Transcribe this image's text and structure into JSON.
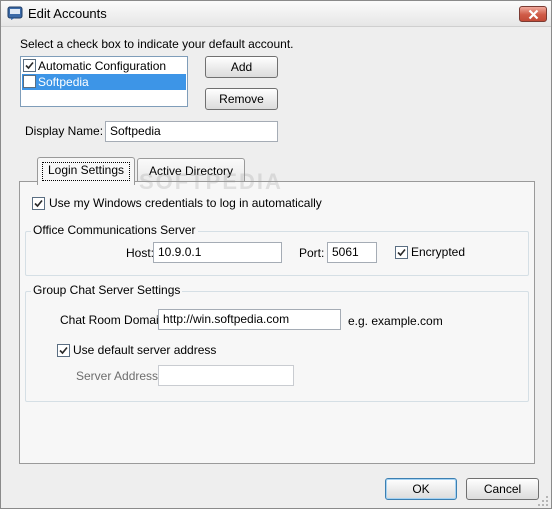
{
  "window": {
    "title": "Edit Accounts"
  },
  "instructions": "Select a check box to indicate your default account.",
  "accounts": [
    {
      "label": "Automatic Configuration",
      "checked": true,
      "selected": false
    },
    {
      "label": "Softpedia",
      "checked": false,
      "selected": true
    }
  ],
  "buttons": {
    "add": "Add",
    "remove": "Remove",
    "ok": "OK",
    "cancel": "Cancel"
  },
  "display_name": {
    "label": "Display Name:",
    "value": "Softpedia"
  },
  "tabs": [
    {
      "label": "Login Settings",
      "active": true
    },
    {
      "label": "Active Directory",
      "active": false
    }
  ],
  "watermark": "SOFTPEDIA",
  "login": {
    "use_windows_credentials": {
      "label": "Use my Windows credentials to log in automatically",
      "checked": true
    },
    "ocs_group": {
      "title": "Office Communications Server",
      "host_label": "Host:",
      "host_value": "10.9.0.1",
      "port_label": "Port:",
      "port_value": "5061",
      "encrypted": {
        "label": "Encrypted",
        "checked": true
      }
    },
    "group_chat": {
      "title": "Group Chat Server Settings",
      "domain_label": "Chat Room Domain:",
      "domain_value": "http://win.softpedia.com",
      "domain_hint": "e.g. example.com",
      "use_default": {
        "label": "Use default server address",
        "checked": true
      },
      "server_address_label": "Server Address:",
      "server_address_value": ""
    }
  },
  "colors": {
    "selection": "#3d95e7",
    "close_button": "#cf5b47"
  }
}
